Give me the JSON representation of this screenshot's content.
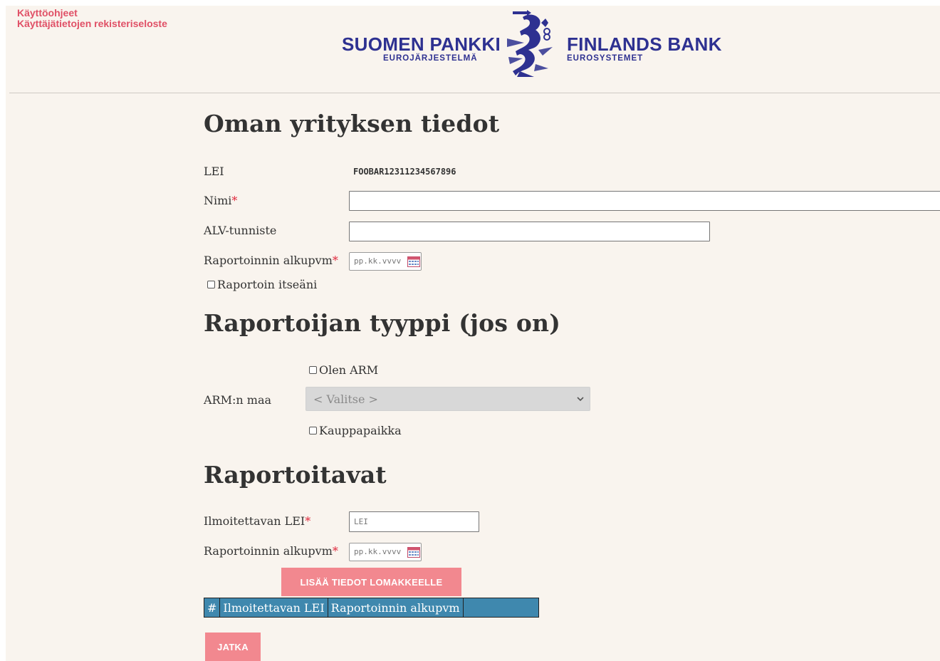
{
  "top_links": {
    "instructions": "Käyttöohjeet",
    "privacy": "Käyttäjätietojen rekisteriseloste"
  },
  "logo": {
    "name_fi": "SUOMEN PANKKI",
    "sub_fi": "EUROJÄRJESTELMÄ",
    "name_sv": "FINLANDS BANK",
    "sub_sv": "EUROSYSTEMET",
    "color": "#2e3191"
  },
  "company_section": {
    "title": "Oman yrityksen tiedot",
    "lei_label": "LEI",
    "lei_value": "FOOBAR12311234567896",
    "name_label": "Nimi",
    "name_value": "",
    "vat_label": "ALV-tunniste",
    "vat_value": "",
    "start_date_label": "Raportoinnin alkupvm",
    "start_date_placeholder": "pp.kk.vvvv",
    "self_report_label": "Raportoin itseäni",
    "required_mark": "*"
  },
  "reporter_type_section": {
    "title": "Raportoijan tyyppi (jos on)",
    "arm_checkbox_label": "Olen ARM",
    "arm_country_label": "ARM:n maa",
    "arm_country_selected": "< Valitse >",
    "marketplace_label": "Kauppapaikka"
  },
  "reportables_section": {
    "title": "Raportoitavat",
    "lei_label": "Ilmoitettavan LEI",
    "lei_placeholder": "LEI",
    "start_date_label": "Raportoinnin alkupvm",
    "start_date_placeholder": "pp.kk.vvvv",
    "add_button": "LISÄÄ TIEDOT LOMAKKEELLE",
    "table_headers": [
      "#",
      "Ilmoitettavan LEI",
      "Raportoinnin alkupvm"
    ],
    "continue_button": "JATKA"
  },
  "colors": {
    "link": "#e05066",
    "button": "#f2888f",
    "table_header": "#3f88ae",
    "background": "#f9f4ee",
    "required": "#e0283c"
  }
}
